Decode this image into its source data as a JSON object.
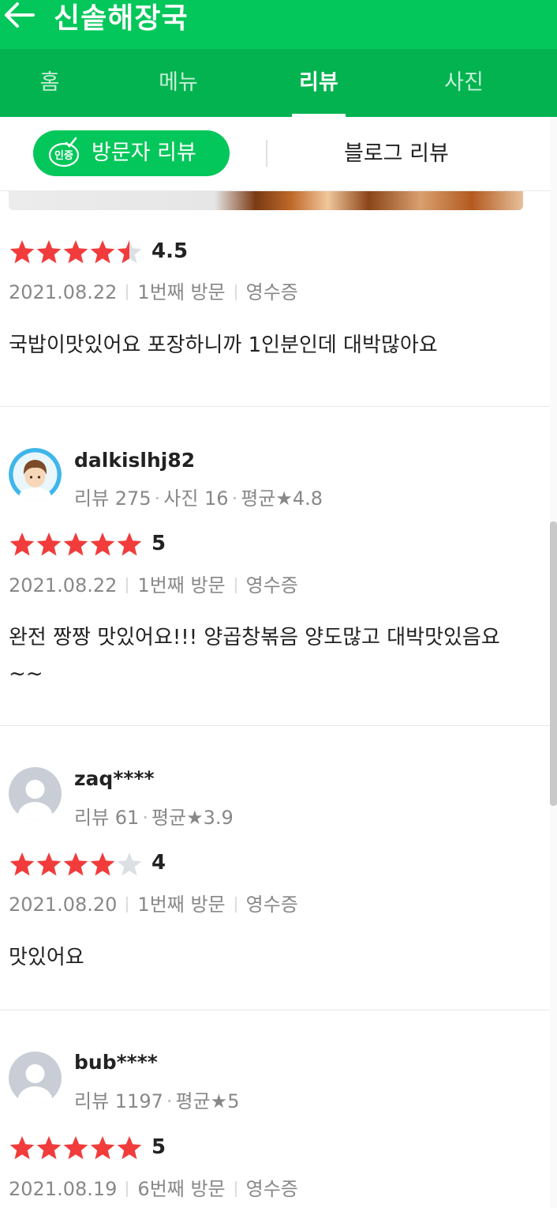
{
  "header": {
    "title": "신솥해장국"
  },
  "tabs": [
    {
      "label": "홈"
    },
    {
      "label": "메뉴"
    },
    {
      "label": "리뷰"
    },
    {
      "label": "사진"
    }
  ],
  "subtabs": {
    "visitor_label": "방문자 리뷰",
    "badge_text": "인증",
    "blog_label": "블로그 리뷰"
  },
  "colors": {
    "brand": "#03c75a",
    "star": "#f23b3b",
    "star_empty": "#dcdfe4"
  },
  "reviews": [
    {
      "rating": "4.5",
      "rating_value": 4.5,
      "date": "2021.08.22",
      "visit": "1번째 방문",
      "proof": "영수증",
      "text": "국밥이맛있어요 포장하니까 1인분인데 대박많아요"
    },
    {
      "username": "dalkislhj82",
      "stats": [
        "리뷰 275",
        "사진 16",
        "평균★4.8"
      ],
      "avatar": "cartoon-avatar",
      "rating": "5",
      "rating_value": 5,
      "date": "2021.08.22",
      "visit": "1번째 방문",
      "proof": "영수증",
      "text": "완전 짱짱 맛있어요!!! 양곱창볶음 양도많고 대박맛있음요~~"
    },
    {
      "username": "zaq****",
      "stats": [
        "리뷰 61",
        "평균★3.9"
      ],
      "avatar": "default-avatar",
      "rating": "4",
      "rating_value": 4,
      "date": "2021.08.20",
      "visit": "1번째 방문",
      "proof": "영수증",
      "text": "맛있어요"
    },
    {
      "username": "bub****",
      "stats": [
        "리뷰 1197",
        "평균★5"
      ],
      "avatar": "default-avatar",
      "rating": "5",
      "rating_value": 5,
      "date": "2021.08.19",
      "visit": "6번째 방문",
      "proof": "영수증"
    }
  ]
}
